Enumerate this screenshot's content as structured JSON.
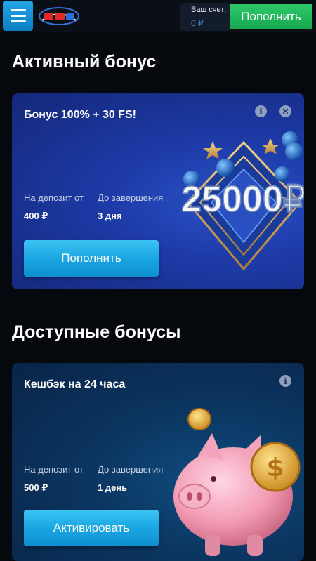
{
  "header": {
    "menu_icon": "hamburger-icon",
    "logo_icon": "brand-logo",
    "account_label": "Ваш счет:",
    "account_balance": "0 ₽",
    "topup_label": "Пополнить"
  },
  "active_section": {
    "title": "Активный бонус",
    "card": {
      "title": "Бонус 100% + 30 FS!",
      "deposit_label": "На депозит от",
      "deposit_value": "400 ₽",
      "until_label": "До завершения",
      "until_value": "3 дня",
      "button_label": "Пополнить",
      "banner_text": "25000₽"
    }
  },
  "available_section": {
    "title": "Доступные бонусы",
    "card": {
      "title": "Кешбэк на 24 часа",
      "deposit_label": "На депозит от",
      "deposit_value": "500 ₽",
      "until_label": "До завершения",
      "until_value": "1 день",
      "button_label": "Активировать"
    }
  },
  "colors": {
    "accent_green": "#2fc86a",
    "accent_blue": "#1aa6e3",
    "balance_blue": "#3d8fd0"
  }
}
